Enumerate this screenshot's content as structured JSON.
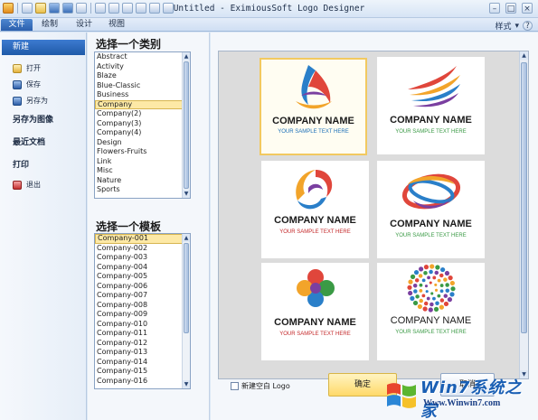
{
  "titlebar": {
    "title": "Untitled - EximiousSoft Logo Designer",
    "window_controls": [
      "–",
      "□",
      "×"
    ]
  },
  "ribbon": {
    "tabs": [
      "文件",
      "绘制",
      "设计",
      "视图"
    ],
    "style_label": "样式",
    "style_arrow": "▾",
    "help_glyph": "?"
  },
  "nav": {
    "new": "新建",
    "open": "打开",
    "save": "保存",
    "save_as": "另存为",
    "save_as_image": "另存为图像",
    "recent": "最近文档",
    "print": "打印",
    "exit": "退出"
  },
  "category": {
    "heading": "选择一个类别",
    "items": [
      "Abstract",
      "Activity",
      "Blaze",
      "Blue-Classic",
      "Business",
      "Company",
      "Company(2)",
      "Company(3)",
      "Company(4)",
      "Design",
      "Flowers-Fruits",
      "Link",
      "Misc",
      "Nature",
      "Sports"
    ],
    "selected": "Company"
  },
  "template": {
    "heading": "选择一个模板",
    "items": [
      "Company-001",
      "Company-002",
      "Company-003",
      "Company-004",
      "Company-005",
      "Company-006",
      "Company-007",
      "Company-008",
      "Company-009",
      "Company-010",
      "Company-011",
      "Company-012",
      "Company-013",
      "Company-014",
      "Company-015",
      "Company-016"
    ],
    "selected": "Company-001"
  },
  "gallery": {
    "cards": [
      {
        "name": "COMPANY NAME",
        "tagline": "YOUR SAMPLE TEXT HERE",
        "tag_color": "#1b6fb8",
        "selected": true
      },
      {
        "name": "COMPANY NAME",
        "tagline": "YOUR SAMPLE TEXT HERE",
        "tag_color": "#3a9a45",
        "selected": false
      },
      {
        "name": "COMPANY NAME",
        "tagline": "YOUR SAMPLE TEXT HERE",
        "tag_color": "#c4282a",
        "selected": false
      },
      {
        "name": "COMPANY NAME",
        "tagline": "YOUR SAMPLE TEXT HERE",
        "tag_color": "#3a9a45",
        "selected": false
      },
      {
        "name": "COMPANY NAME",
        "tagline": "YOUR SAMPLE TEXT HERE",
        "tag_color": "#c4282a",
        "selected": false
      },
      {
        "name": "COMPANY NAME",
        "tagline": "YOUR SAMPLE TEXT HERE",
        "tag_color": "#3a9a45",
        "selected": false
      }
    ]
  },
  "bottom": {
    "blank_logo": "新建空白 Logo",
    "ok": "确定",
    "cancel": "取消"
  },
  "watermark": {
    "brand": "Win7系统之家",
    "url": "Www.Winwin7.com"
  },
  "colors": {
    "accent": "#2b5fad",
    "selection": "#fde9a6"
  }
}
